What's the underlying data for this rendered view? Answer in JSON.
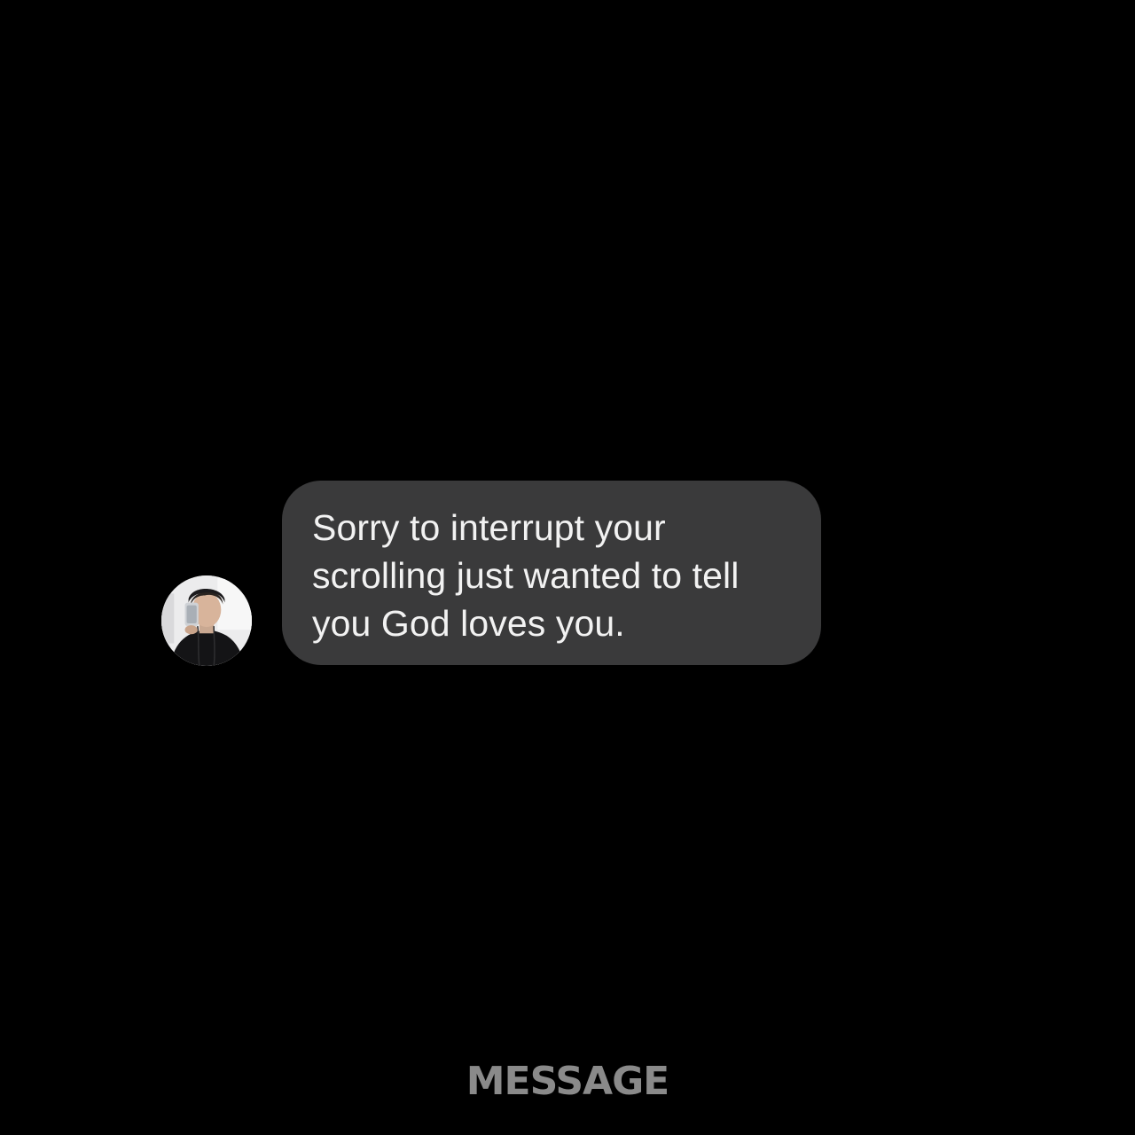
{
  "conversation": {
    "sender_avatar_icon": "profile-photo",
    "message": {
      "text": "Sorry to interrupt your scrolling just wanted to tell you God loves you."
    }
  },
  "footer": {
    "label": "MESSAGE"
  },
  "colors": {
    "background": "#000000",
    "bubble": "#3a3a3b",
    "message_text": "#f2f2f2",
    "footer_text": "#8a8a8a"
  }
}
